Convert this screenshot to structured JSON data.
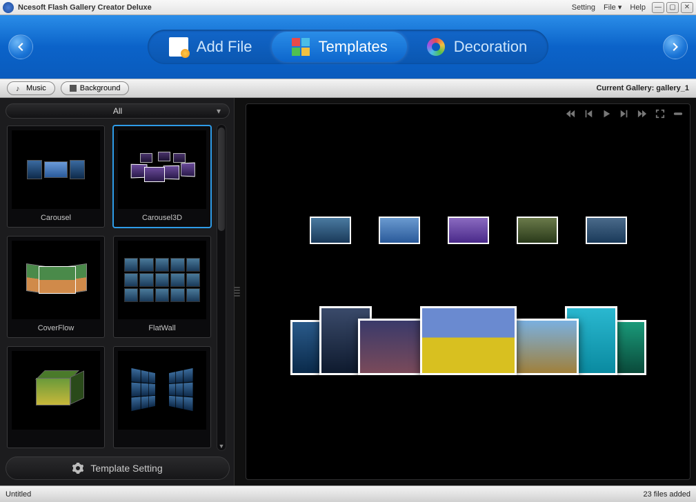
{
  "titlebar": {
    "title": "Ncesoft Flash Gallery Creator Deluxe",
    "menu": {
      "setting": "Setting",
      "file": "File",
      "help": "Help"
    }
  },
  "topnav": {
    "add_file": "Add File",
    "templates": "Templates",
    "decoration": "Decoration"
  },
  "subtoolbar": {
    "music": "Music",
    "background": "Background",
    "current_gallery_label": "Current Gallery: ",
    "current_gallery_name": "gallery_1"
  },
  "sidebar": {
    "filter_dropdown": "All",
    "templates": [
      {
        "label": "Carousel"
      },
      {
        "label": "Carousel3D"
      },
      {
        "label": "CoverFlow"
      },
      {
        "label": "FlatWall"
      },
      {
        "label": ""
      },
      {
        "label": ""
      }
    ],
    "template_setting": "Template Setting"
  },
  "statusbar": {
    "document": "Untitled",
    "files_added": "23 files added"
  }
}
